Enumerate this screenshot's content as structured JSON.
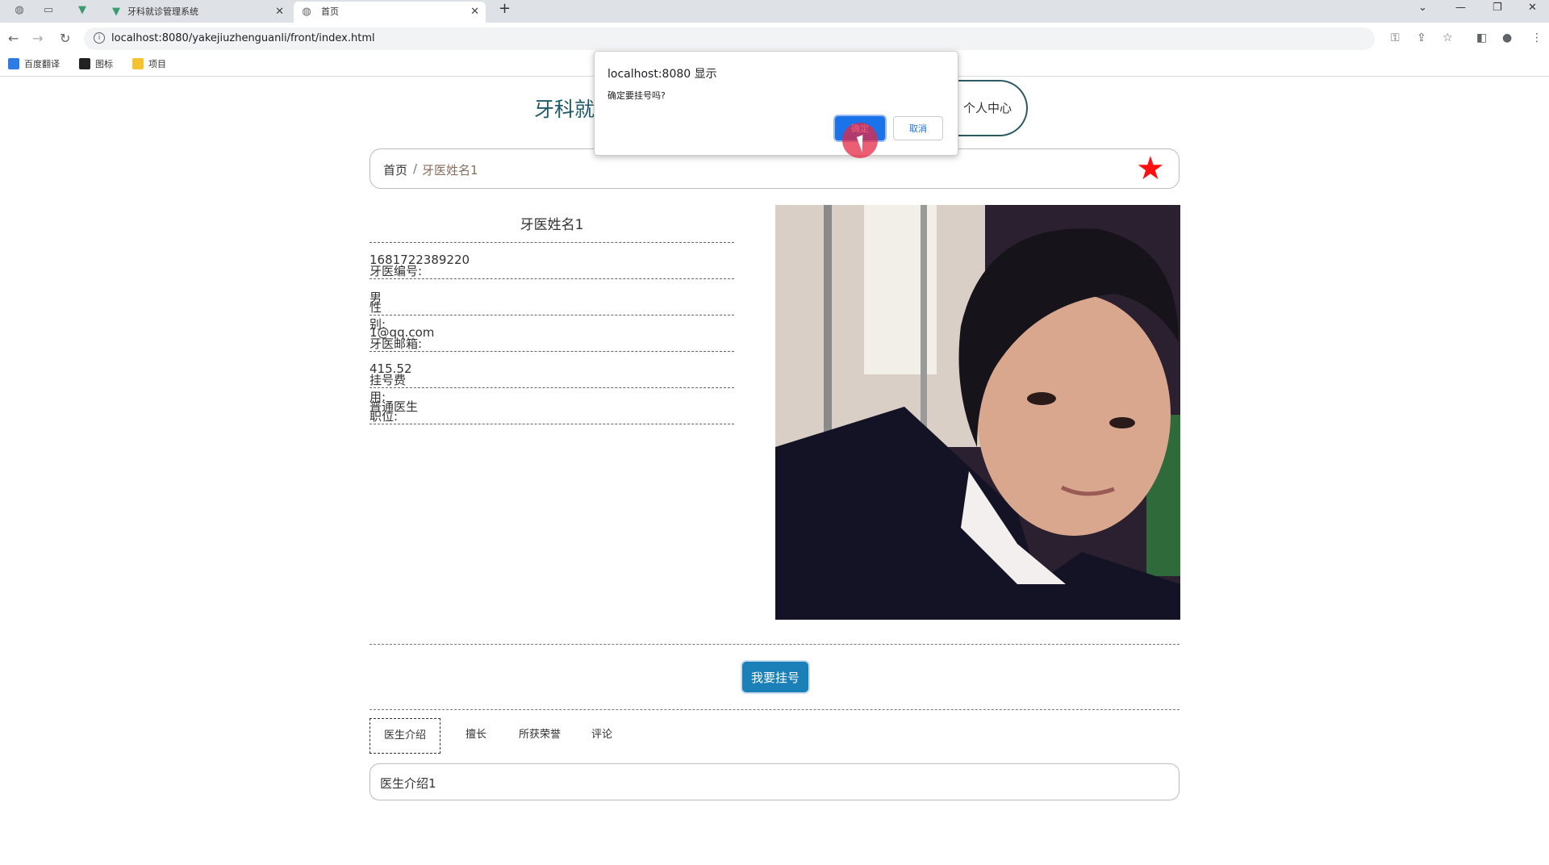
{
  "browser": {
    "tabs": [
      {
        "label": "",
        "icon": "globe-icon"
      },
      {
        "label": "",
        "icon": "blank-tab-icon"
      },
      {
        "label": "",
        "icon": "vue-logo-icon"
      },
      {
        "label": "牙科就诊管理系统",
        "icon": "vue-logo-icon"
      },
      {
        "label": "首页",
        "icon": "globe-icon"
      }
    ],
    "url": "localhost:8080/yakejiuzhenguanli/front/index.html",
    "bookmarks": [
      "百度翻译",
      "图标",
      "项目"
    ]
  },
  "header": {
    "site_title": "牙科就",
    "user_center": "个人中心"
  },
  "breadcrumb": {
    "home": "首页",
    "separator": "/",
    "current": "牙医姓名1"
  },
  "doctor": {
    "name": "牙医姓名1",
    "fields": [
      {
        "label": "牙医编号:",
        "value": "1681722389220"
      },
      {
        "label": "性别:",
        "value": "男"
      },
      {
        "label": "牙医邮箱:",
        "value": "1@qq.com"
      },
      {
        "label": "挂号费用:",
        "value": "415.52"
      },
      {
        "label": "职位:",
        "value": "普通医生"
      }
    ],
    "register_button": "我要挂号"
  },
  "detail_tabs": [
    {
      "label": "医生介绍",
      "active": true
    },
    {
      "label": "擅长",
      "active": false
    },
    {
      "label": "所获荣誉",
      "active": false
    },
    {
      "label": "评论",
      "active": false
    }
  ],
  "tab_content": "医生介绍1",
  "dialog": {
    "title": "localhost:8080 显示",
    "message": "确定要挂号吗?",
    "ok": "确定",
    "cancel": "取消"
  },
  "colors": {
    "accent": "#1b7fb8",
    "title": "#1e5a6a",
    "star": "#ff1010",
    "dialog_ok": "#1a73e8"
  }
}
